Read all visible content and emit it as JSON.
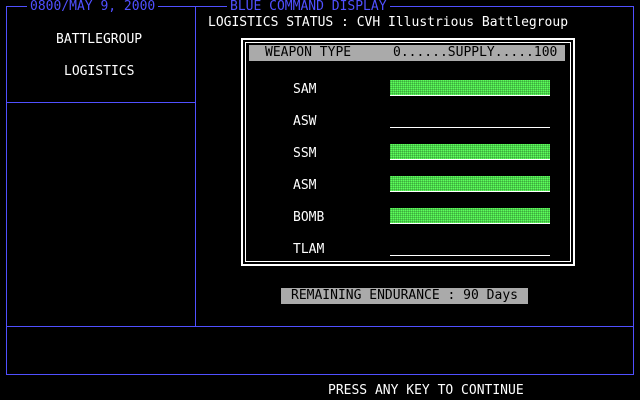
{
  "header": {
    "datetime": "0800/MAY  9, 2000",
    "title": "BLUE  COMMAND DISPLAY"
  },
  "menu": {
    "items": [
      {
        "label": "BATTLEGROUP"
      },
      {
        "label": "LOGISTICS"
      }
    ]
  },
  "status_title": "LOGISTICS STATUS : CVH Illustrious Battlegroup",
  "table": {
    "header_left": "WEAPON TYPE",
    "header_right": "0......SUPPLY.....100",
    "rows": [
      {
        "label": "SAM",
        "supply": 100
      },
      {
        "label": "ASW",
        "supply": 0
      },
      {
        "label": "SSM",
        "supply": 100
      },
      {
        "label": "ASM",
        "supply": 100
      },
      {
        "label": "BOMB",
        "supply": 100
      },
      {
        "label": "TLAM",
        "supply": 0
      }
    ]
  },
  "endurance": "REMAINING ENDURANCE : 90 Days",
  "footer": {
    "prompt": "PRESS ANY KEY TO CONTINUE"
  },
  "colors": {
    "frame": "#5050ff",
    "bar": "#5cff5c",
    "highlight": "#aaaaaa"
  }
}
